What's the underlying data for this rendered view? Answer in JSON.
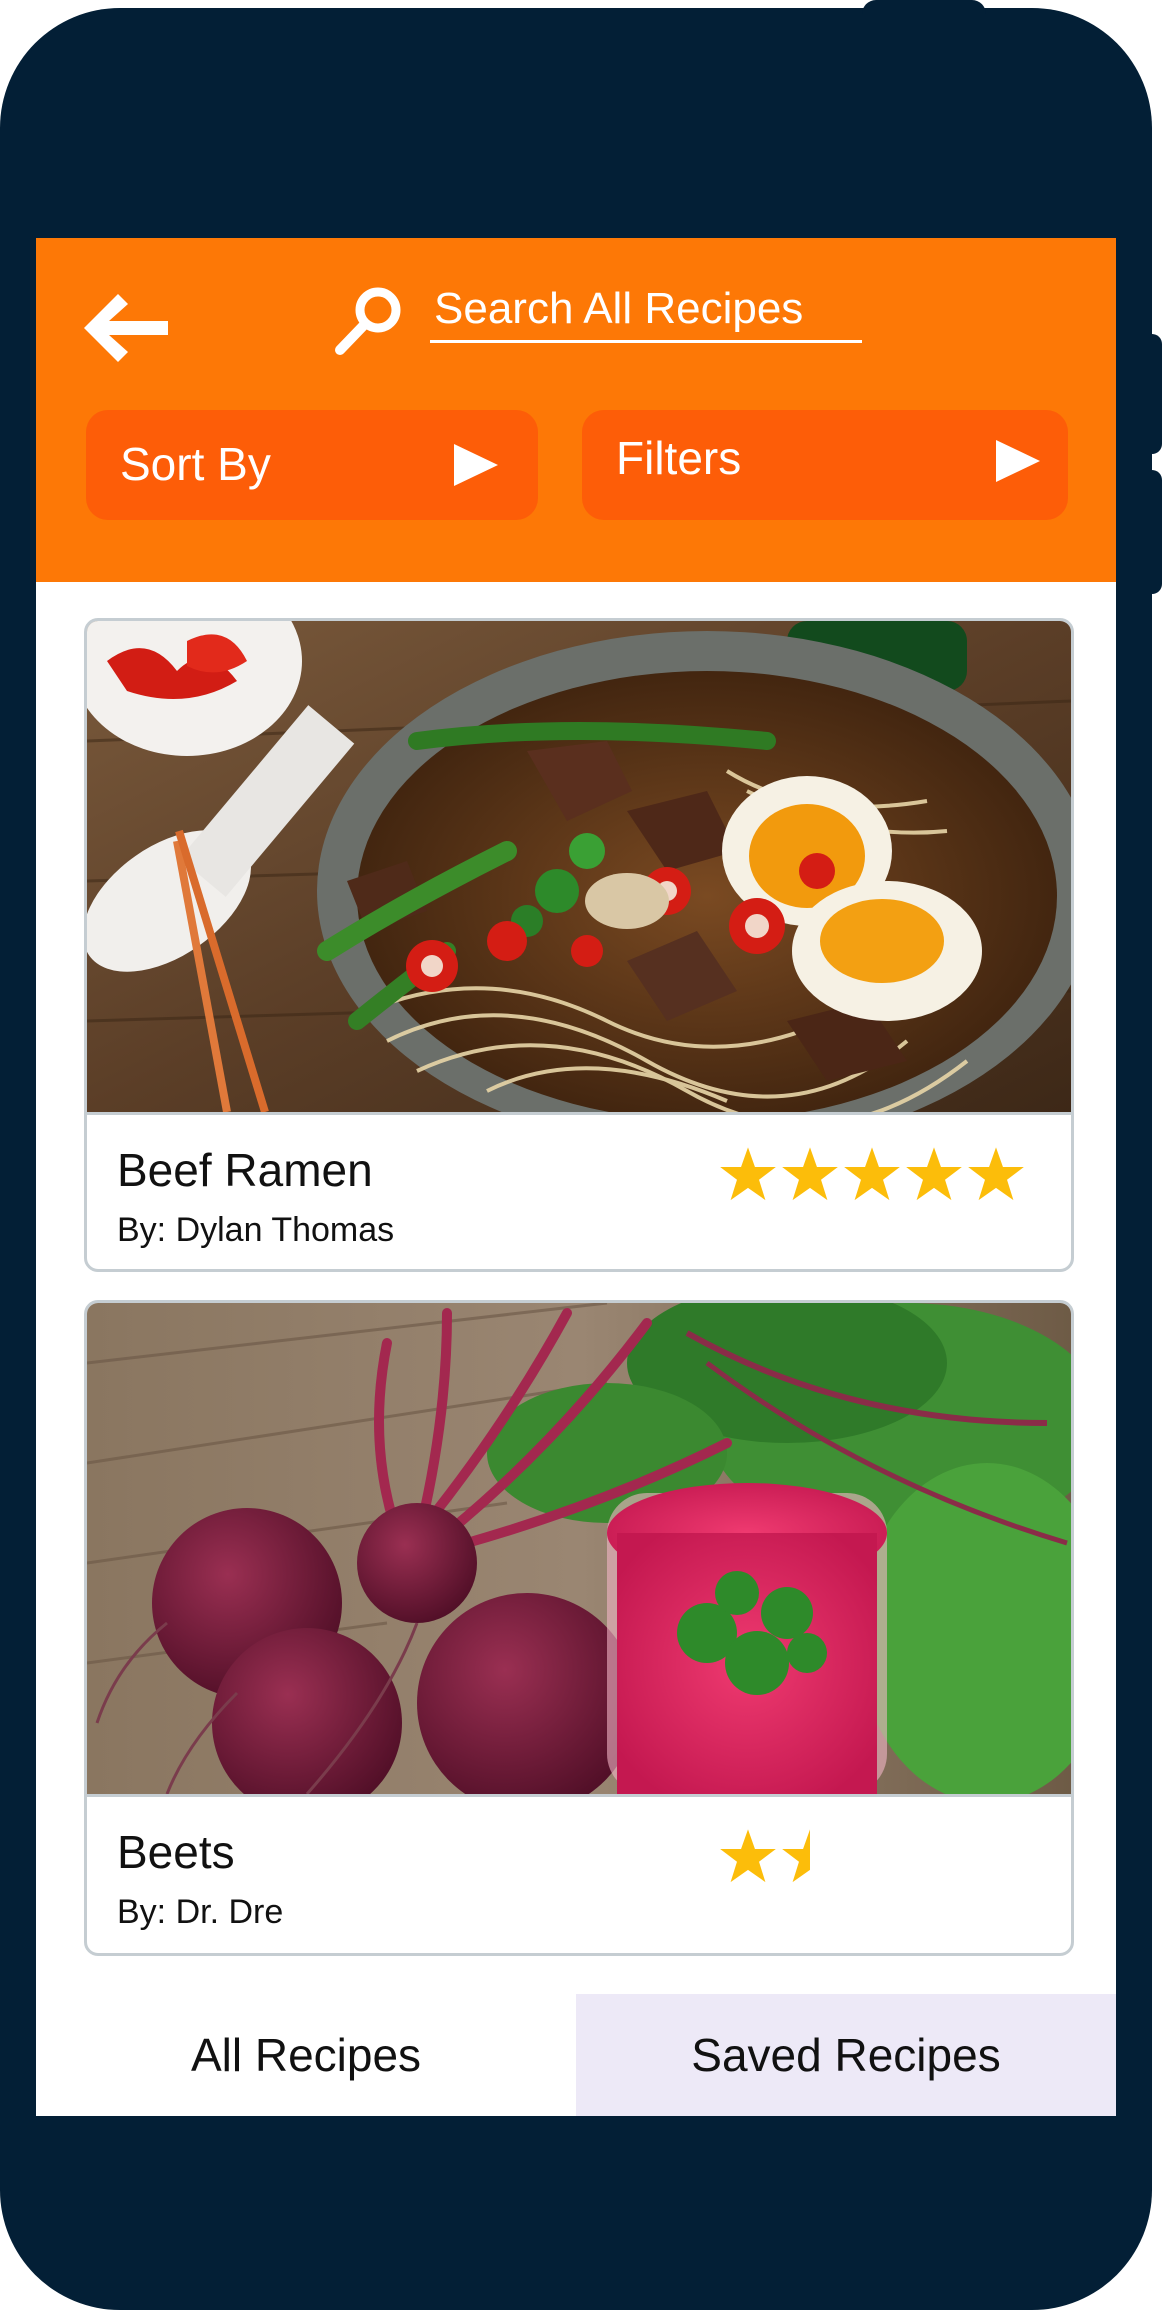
{
  "header": {
    "search_placeholder": "Search All Recipes",
    "sort_label": "Sort By",
    "filters_label": "Filters",
    "accent_color": "#fd7806",
    "pill_color": "#fd5d08"
  },
  "icons": {
    "back": "arrow-left-icon",
    "search": "magnifier-icon",
    "sort": "triangle-right-icon",
    "filters": "triangle-right-icon",
    "star": "star-icon"
  },
  "recipes": [
    {
      "title": "Beef Ramen",
      "author": "By: Dylan Thomas",
      "rating": 5,
      "image": "beef-ramen-photo"
    },
    {
      "title": "Beets",
      "author": "By: Dr. Dre",
      "rating": 1.5,
      "image": "beets-photo"
    }
  ],
  "tabs": {
    "all": "All Recipes",
    "saved": "Saved Recipes"
  },
  "colors": {
    "frame": "#031f36",
    "star": "#fcbd0a",
    "saved_tab_bg": "#ede9f7"
  }
}
